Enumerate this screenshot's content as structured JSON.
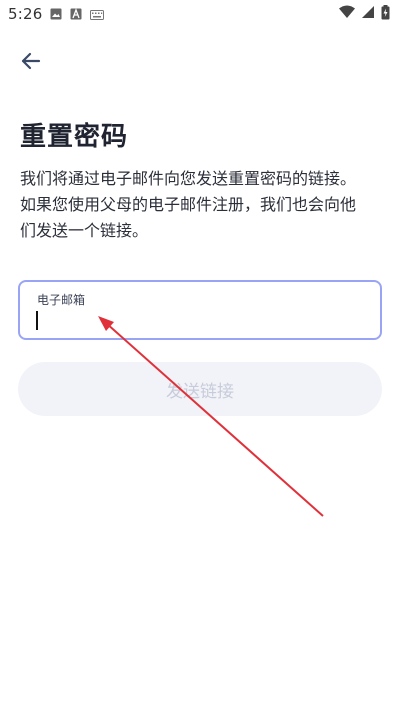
{
  "status_bar": {
    "time": "5:26",
    "left_icons": [
      "image-icon",
      "a-letter-icon",
      "keyboard-icon"
    ],
    "right_icons": [
      "wifi-icon",
      "cellular-icon",
      "battery-charging-icon"
    ]
  },
  "header": {
    "back_icon": "arrow-left-icon"
  },
  "page": {
    "title": "重置密码",
    "description": "我们将通过电子邮件向您发送重置密码的链接。如果您使用父母的电子邮件注册，我们也会向他们发送一个链接。"
  },
  "form": {
    "email_label": "电子邮箱",
    "email_value": "",
    "submit_label": "发送链接"
  },
  "colors": {
    "accent_border": "#9aa4f5",
    "annotation_arrow": "#e0313a",
    "disabled_button_bg": "#f2f3f8",
    "disabled_button_text": "#c8ccda"
  }
}
